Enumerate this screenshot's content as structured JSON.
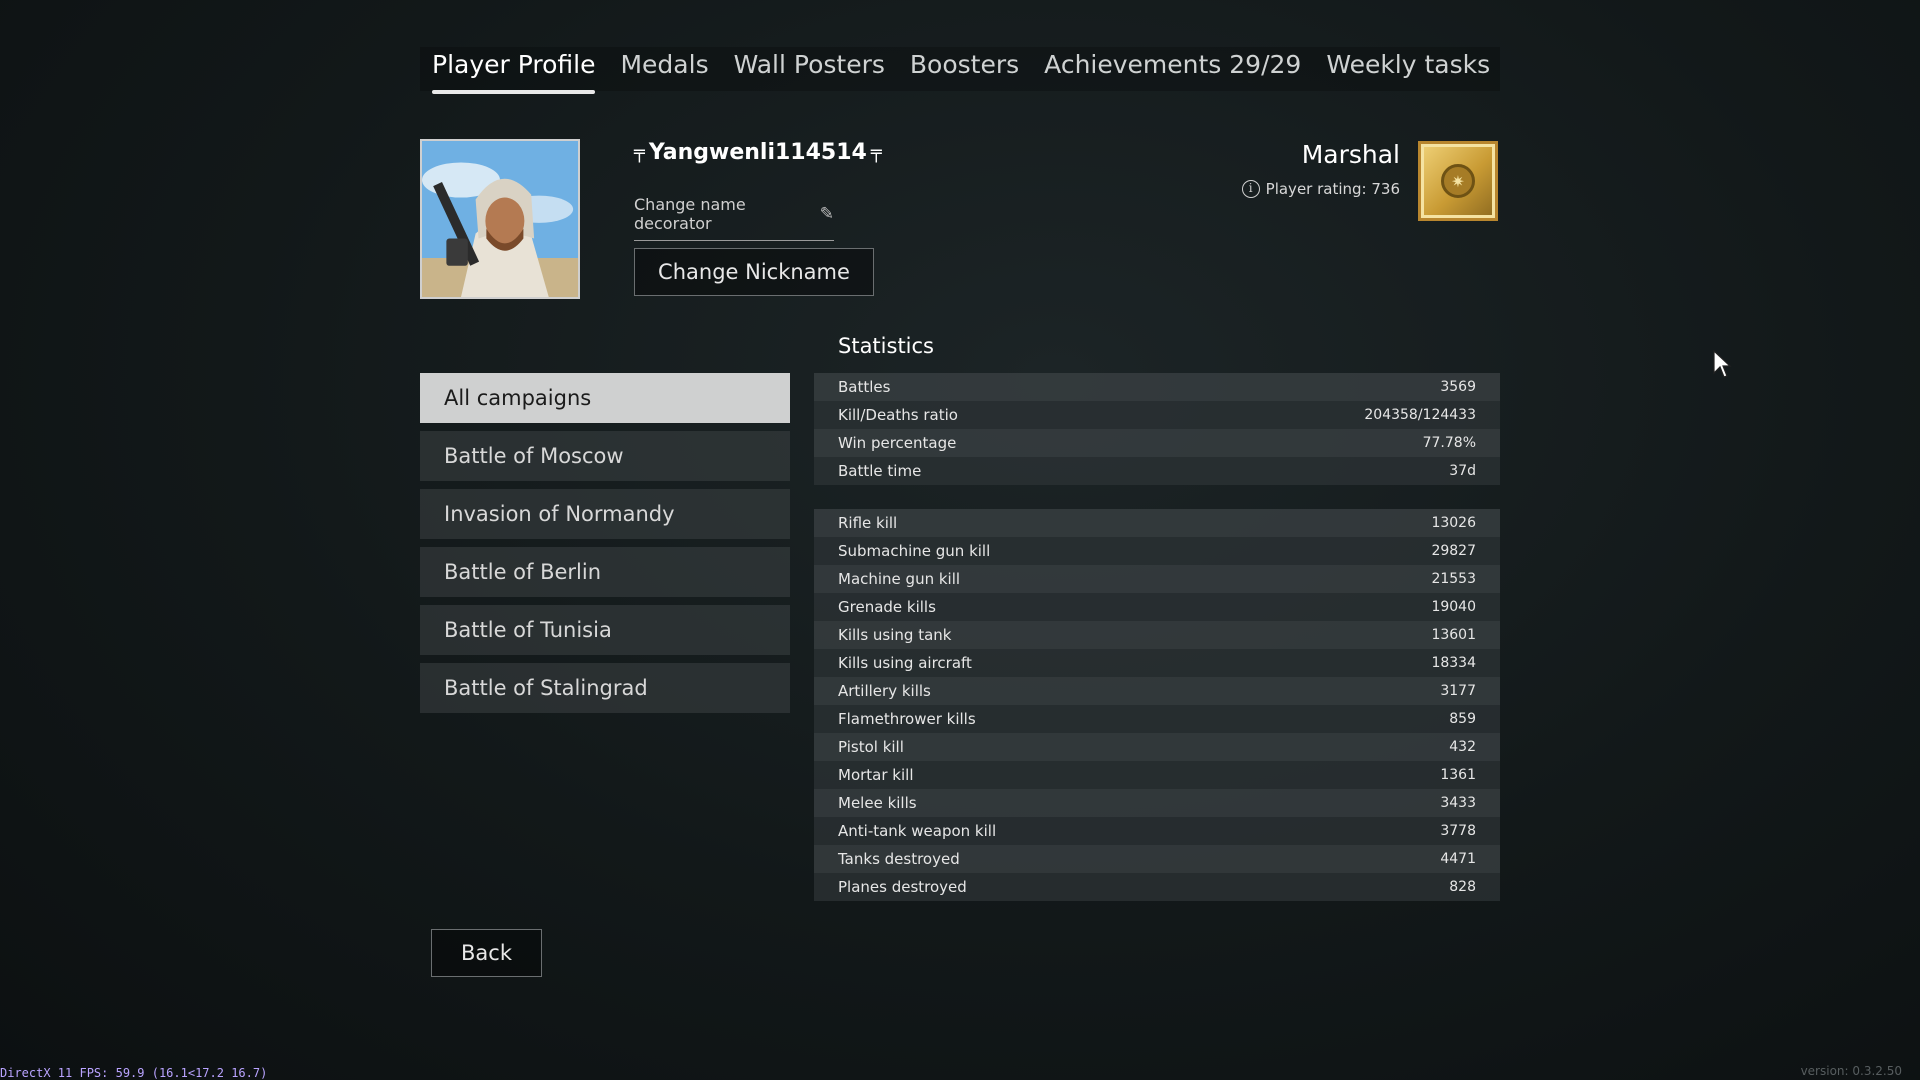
{
  "tabs": [
    {
      "label": "Player Profile",
      "active": true
    },
    {
      "label": "Medals"
    },
    {
      "label": "Wall Posters"
    },
    {
      "label": "Boosters"
    },
    {
      "label": "Achievements 29/29"
    },
    {
      "label": "Weekly tasks"
    }
  ],
  "profile": {
    "nickname": "Yangwenli114514",
    "change_decorator_label": "Change name decorator",
    "change_nickname_label": "Change Nickname",
    "rank": "Marshal",
    "rating_text": "Player rating: 736"
  },
  "campaigns": [
    {
      "label": "All campaigns",
      "active": true
    },
    {
      "label": "Battle of Moscow"
    },
    {
      "label": "Invasion of Normandy"
    },
    {
      "label": "Battle of Berlin"
    },
    {
      "label": "Battle of Tunisia"
    },
    {
      "label": "Battle of Stalingrad"
    }
  ],
  "statistics": {
    "title": "Statistics",
    "general": [
      {
        "label": "Battles",
        "value": "3569"
      },
      {
        "label": "Kill/Deaths ratio",
        "value": "204358/124433"
      },
      {
        "label": "Win percentage",
        "value": "77.78%"
      },
      {
        "label": "Battle time",
        "value": "37d"
      }
    ],
    "kills": [
      {
        "label": "Rifle kill",
        "value": "13026"
      },
      {
        "label": "Submachine gun kill",
        "value": "29827"
      },
      {
        "label": "Machine gun kill",
        "value": "21553"
      },
      {
        "label": "Grenade kills",
        "value": "19040"
      },
      {
        "label": "Kills using tank",
        "value": "13601"
      },
      {
        "label": "Kills using aircraft",
        "value": "18334"
      },
      {
        "label": "Artillery kills",
        "value": "3177"
      },
      {
        "label": "Flamethrower kills",
        "value": "859"
      },
      {
        "label": "Pistol kill",
        "value": "432"
      },
      {
        "label": "Mortar kill",
        "value": "1361"
      },
      {
        "label": "Melee kills",
        "value": "3433"
      },
      {
        "label": "Anti-tank weapon kill",
        "value": "3778"
      },
      {
        "label": "Tanks destroyed",
        "value": "4471"
      },
      {
        "label": "Planes destroyed",
        "value": "828"
      }
    ]
  },
  "back_label": "Back",
  "footer": {
    "fps_text": "DirectX 11 FPS: 59.9 (16.1<17.2 16.7)",
    "version_text": "version: 0.3.2.50"
  },
  "icons": {
    "pencil": "pencil-icon",
    "info": "info-icon",
    "rank_badge": "rank-badge-icon",
    "cursor": "mouse-cursor-icon"
  },
  "colors": {
    "background": "#121819",
    "active_campaign": "#cfd0d0",
    "badge_gold": "#c99b34",
    "fps_text": "#b9a3ff"
  }
}
